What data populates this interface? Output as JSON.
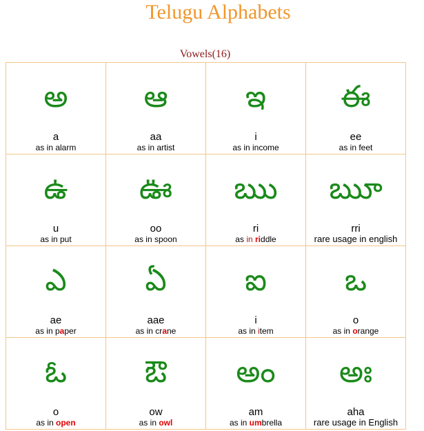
{
  "page": {
    "title": "Telugu Alphabets",
    "subtitle": "Vowels(16)"
  },
  "vowels": [
    {
      "glyph": "అ",
      "roman": "a",
      "ex_pre": "as in alarm",
      "ex_hl": "",
      "ex_post": ""
    },
    {
      "glyph": "ఆ",
      "roman": "aa",
      "ex_pre": "as in artist",
      "ex_hl": "",
      "ex_post": ""
    },
    {
      "glyph": "ఇ",
      "roman": "i",
      "ex_pre": "as in income",
      "ex_hl": "",
      "ex_post": ""
    },
    {
      "glyph": "ఈ",
      "roman": "ee",
      "ex_pre": "as in feet",
      "ex_hl": "",
      "ex_post": ""
    },
    {
      "glyph": "ఉ",
      "roman": "u",
      "ex_pre": "as in put",
      "ex_hl": "",
      "ex_post": ""
    },
    {
      "glyph": "ఊ",
      "roman": "oo",
      "ex_pre": "as in spoon",
      "ex_hl": "",
      "ex_post": ""
    },
    {
      "glyph": "ఋ",
      "roman": "ri",
      "ex_pre": "as ",
      "ex_red": "in ",
      "ex_hl": "ri",
      "ex_post": "ddle"
    },
    {
      "glyph": "ౠ",
      "roman": "rri",
      "ex_pre": "rare usage in english",
      "ex_hl": "",
      "ex_post": ""
    },
    {
      "glyph": "ఎ",
      "roman": "ae",
      "ex_pre": "as in p",
      "ex_hl": "a",
      "ex_post": "per"
    },
    {
      "glyph": "ఏ",
      "roman": "aae",
      "ex_pre": "as in cr",
      "ex_hl": "a",
      "ex_post": "ne"
    },
    {
      "glyph": "ఐ",
      "roman": "i",
      "ex_pre": "as in ",
      "ex_red": "i",
      "ex_hl": "",
      "ex_post": "tem"
    },
    {
      "glyph": "ఒ",
      "roman": "o",
      "ex_pre": "as in ",
      "ex_hl": "o",
      "ex_post": "range"
    },
    {
      "glyph": "ఓ",
      "roman": "o",
      "ex_pre": "as in ",
      "ex_hl": "open",
      "ex_post": ""
    },
    {
      "glyph": "ఔ",
      "roman": "ow",
      "ex_pre": "as in ",
      "ex_hl": "owl",
      "ex_post": ""
    },
    {
      "glyph": "అం",
      "roman": "am",
      "ex_pre": "as in ",
      "ex_hl": "um",
      "ex_post": "brella"
    },
    {
      "glyph": "అః",
      "roman": "aha",
      "ex_pre": "rare usage in English",
      "ex_hl": "",
      "ex_post": ""
    }
  ],
  "colors": {
    "title": "#f0962b",
    "subtitle": "#8b1a1a",
    "glyph": "#1a8a1a",
    "border": "#f5c58a",
    "highlight": "#e00000"
  }
}
